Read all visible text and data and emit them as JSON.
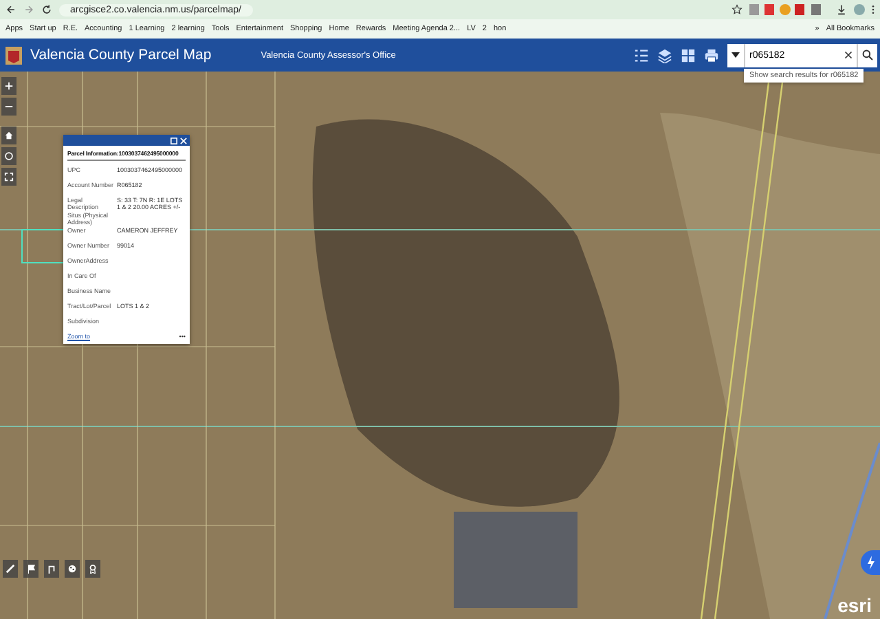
{
  "browser": {
    "url": "arcgisce2.co.valencia.nm.us/parcelmap/",
    "bookmarks": [
      "Apps",
      "Start up",
      "R.E.",
      "Accounting",
      "1 Learning",
      "2 learning",
      "Tools",
      "Entertainment",
      "Shopping",
      "Home",
      "Rewards",
      "Meeting Agenda 2...",
      "LV",
      "2",
      "hon"
    ],
    "more": "»",
    "all_bookmarks": "All Bookmarks"
  },
  "header": {
    "title": "Valencia County Parcel Map",
    "subtitle": "Valencia County Assessor's Office"
  },
  "search": {
    "value": "r065182",
    "suggestion": "Show search results for r065182"
  },
  "popup": {
    "title": "Parcel Information:1003037462495000000",
    "fields": [
      {
        "label": "UPC",
        "value": "1003037462495000000"
      },
      {
        "label": "Account Number",
        "value": "R065182"
      },
      {
        "label": "Legal Description",
        "value": "S: 33 T: 7N R: 1E LOTS 1 & 2 20.00 ACRES +/-"
      },
      {
        "label": "Situs (Physical Address)"
      },
      {
        "label": "Owner",
        "value": "CAMERON JEFFREY"
      },
      {
        "label": "Owner Number",
        "value": "99014"
      },
      {
        "label": "OwnerAddress"
      },
      {
        "label": "In Care Of"
      },
      {
        "label": "Business Name"
      },
      {
        "label": "Tract/Lot/Parcel",
        "value": "LOTS 1 & 2"
      },
      {
        "label": "Subdivision"
      }
    ],
    "link": "Zoom to",
    "more": "•••"
  },
  "attribution": "esri"
}
